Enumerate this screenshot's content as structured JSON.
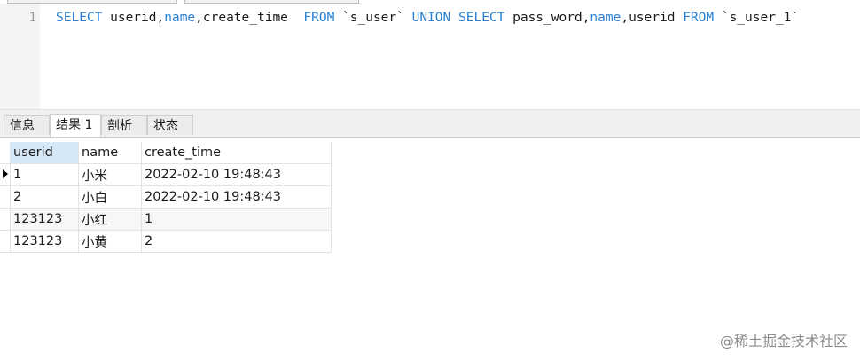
{
  "editor": {
    "line_number": "1",
    "sql": [
      {
        "t": "kw",
        "v": "SELECT"
      },
      {
        "t": "tx",
        "v": " userid,"
      },
      {
        "t": "kw",
        "v": "name"
      },
      {
        "t": "tx",
        "v": ",create_time  "
      },
      {
        "t": "kw",
        "v": "FROM"
      },
      {
        "t": "tx",
        "v": " `s_user` "
      },
      {
        "t": "kw",
        "v": "UNION"
      },
      {
        "t": "tx",
        "v": " "
      },
      {
        "t": "kw",
        "v": "SELECT"
      },
      {
        "t": "tx",
        "v": " pass_word,"
      },
      {
        "t": "kw",
        "v": "name"
      },
      {
        "t": "tx",
        "v": ",userid "
      },
      {
        "t": "kw",
        "v": "FROM"
      },
      {
        "t": "tx",
        "v": " `s_user_1`"
      }
    ]
  },
  "tabs": [
    "信息",
    "结果 1",
    "剖析",
    "状态"
  ],
  "active_tab": 1,
  "grid": {
    "columns": [
      "userid",
      "name",
      "create_time"
    ],
    "rows": [
      [
        "1",
        "小米",
        "2022-02-10 19:48:43"
      ],
      [
        "2",
        "小白",
        "2022-02-10 19:48:43"
      ],
      [
        "123123",
        "小红",
        "1"
      ],
      [
        "123123",
        "小黄",
        "2"
      ]
    ]
  },
  "watermark": "@稀土掘金技术社区"
}
